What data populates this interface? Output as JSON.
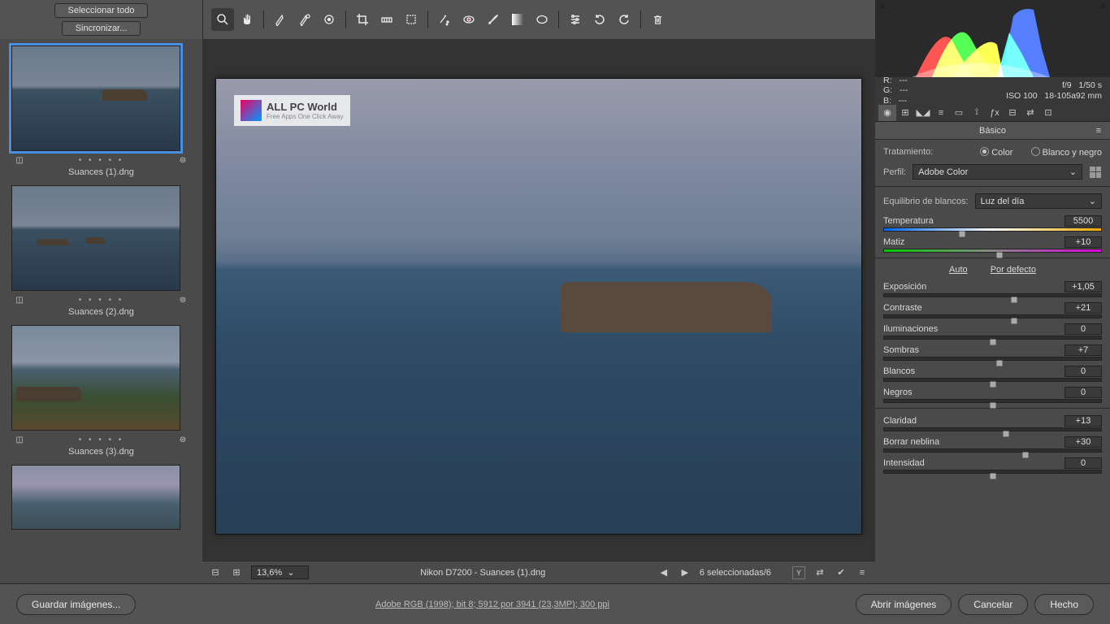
{
  "filmstrip_hdr": {
    "select_all": "Seleccionar todo",
    "sync": "Sincronizar..."
  },
  "thumbs": [
    {
      "name": "Suances (1).dng",
      "selected": true
    },
    {
      "name": "Suances (2).dng",
      "selected": false
    },
    {
      "name": "Suances (3).dng",
      "selected": false
    }
  ],
  "watermark": {
    "title": "ALL PC World",
    "sub": "Free Apps One Click Away"
  },
  "status": {
    "zoom": "13,6%",
    "camera": "Nikon D7200  -  Suances (1).dng",
    "selection": "6 seleccionadas/6"
  },
  "readout": {
    "r": "R:",
    "rv": "---",
    "g": "G:",
    "gv": "---",
    "b": "B:",
    "bv": "---",
    "aperture": "f/9",
    "shutter": "1/50 s",
    "iso": "ISO 100",
    "lens": "18-105a92 mm"
  },
  "panel": {
    "title": "Básico",
    "treatment_label": "Tratamiento:",
    "color": "Color",
    "bw": "Blanco y negro",
    "profile_label": "Perfil:",
    "profile_value": "Adobe Color",
    "wb_label": "Equilibrio de blancos:",
    "wb_value": "Luz del día",
    "temp_label": "Temperatura",
    "temp_value": "5500",
    "tint_label": "Matiz",
    "tint_value": "+10",
    "auto": "Auto",
    "default": "Por defecto",
    "exposure": "Exposición",
    "exposure_v": "+1,05",
    "contrast": "Contraste",
    "contrast_v": "+21",
    "highlights": "Iluminaciones",
    "highlights_v": "0",
    "shadows": "Sombras",
    "shadows_v": "+7",
    "whites": "Blancos",
    "whites_v": "0",
    "blacks": "Negros",
    "blacks_v": "0",
    "clarity": "Claridad",
    "clarity_v": "+13",
    "dehaze": "Borrar neblina",
    "dehaze_v": "+30",
    "vibrance": "Intensidad",
    "vibrance_v": "0"
  },
  "footer": {
    "save": "Guardar imágenes...",
    "info": "Adobe RGB (1998); bit 8; 5912 por 3941 (23,3MP); 300 ppi",
    "open": "Abrir imágenes",
    "cancel": "Cancelar",
    "done": "Hecho"
  }
}
